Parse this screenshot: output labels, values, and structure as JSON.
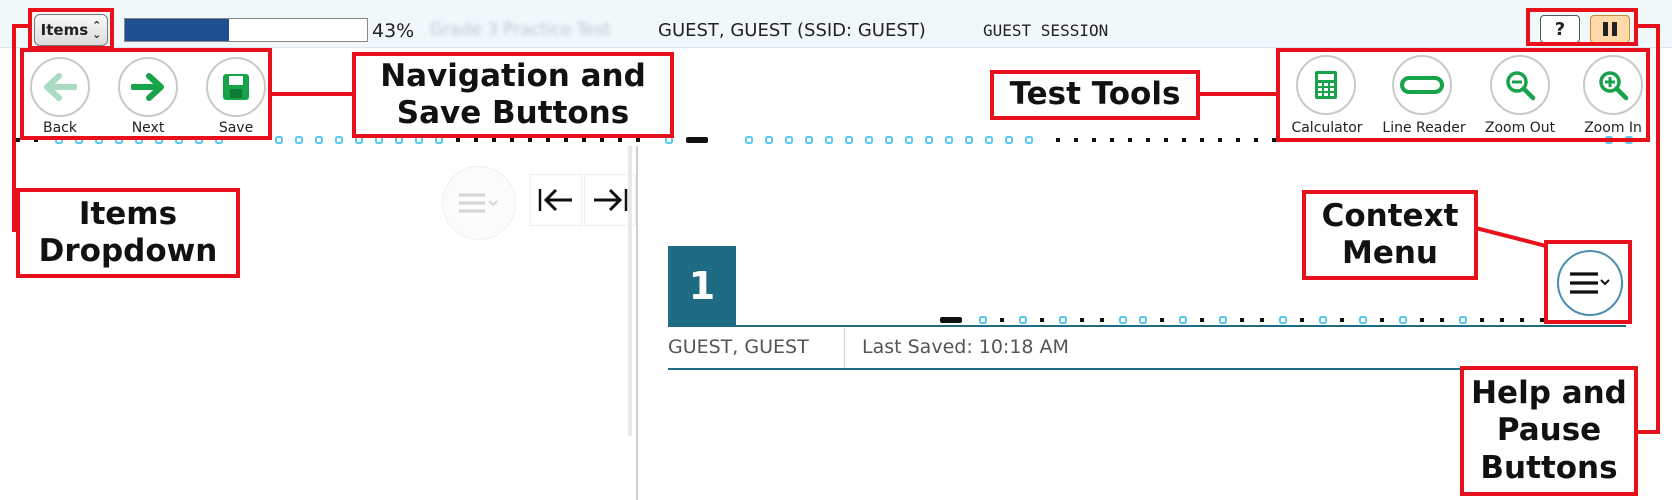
{
  "topbar": {
    "items_dropdown_label": "Items",
    "progress_percent": 43,
    "progress_text": "43%",
    "test_name": "Grade 3 Practice Test",
    "student_info": "GUEST, GUEST (SSID: GUEST)",
    "session": "GUEST SESSION",
    "help_label": "?"
  },
  "nav": {
    "back_label": "Back",
    "next_label": "Next",
    "save_label": "Save"
  },
  "tools": {
    "calculator_label": "Calculator",
    "line_reader_label": "Line Reader",
    "zoom_out_label": "Zoom Out",
    "zoom_in_label": "Zoom In"
  },
  "item": {
    "number": "1",
    "student": "GUEST, GUEST",
    "last_saved": "Last Saved: 10:18 AM"
  },
  "callouts": {
    "nav_save": "Navigation and Save Buttons",
    "test_tools": "Test Tools",
    "items_dropdown": "Items Dropdown",
    "context_menu": "Context Menu",
    "help_pause": "Help and Pause Buttons"
  },
  "icons": {
    "back": "arrow-left-icon",
    "next": "arrow-right-icon",
    "save": "floppy-disk-icon",
    "calculator": "calculator-icon",
    "line_reader": "line-reader-icon",
    "zoom_out": "zoom-out-icon",
    "zoom_in": "zoom-in-icon",
    "context_menu": "menu-icon",
    "pause": "pause-icon"
  },
  "colors": {
    "accent_green": "#16a34a",
    "progress_blue": "#1f4f8f",
    "item_teal": "#1e6b84",
    "annotation_red": "#e8101a",
    "pause_orange": "#ffd9a8"
  }
}
